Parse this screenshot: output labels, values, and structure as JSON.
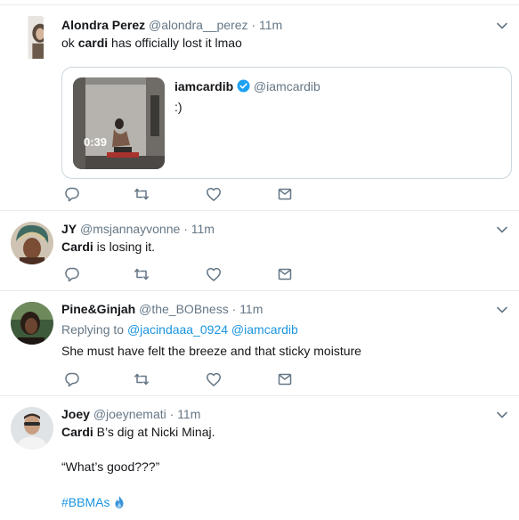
{
  "tweets": [
    {
      "name": "Alondra Perez",
      "handle": "@alondra__perez",
      "time": "11m",
      "text_pre": "ok ",
      "text_keyword": "cardi",
      "text_post": " has officially lost it lmao",
      "quoted": {
        "name": "iamcardib",
        "handle": "@iamcardib",
        "text": ":)",
        "video_duration": "0:39"
      }
    },
    {
      "name": "JY",
      "handle": "@msjannayvonne",
      "time": "11m",
      "text_keyword": "Cardi",
      "text_post": " is losing it."
    },
    {
      "name": "Pine&Ginjah",
      "handle": "@the_BOBness",
      "time": "11m",
      "reply_prefix": "Replying to ",
      "reply_to_1": "@jacindaaa_0924",
      "reply_to_2": "@iamcardib",
      "text": "She must have felt the breeze and that sticky moisture"
    },
    {
      "name": "Joey",
      "handle": "@joeynemati",
      "time": "11m",
      "text_keyword": "Cardi",
      "text_post": " B’s dig at Nicki Minaj.",
      "line2": "“What’s good???”",
      "hashtag": "#BBMAs"
    }
  ],
  "colors": {
    "accent": "#1b95e0",
    "icon_gray": "#657786",
    "verified": "#1da1f2"
  },
  "icons": [
    "reply-icon",
    "retweet-icon",
    "like-icon",
    "direct-message-icon",
    "chevron-down-icon",
    "verified-badge-icon",
    "fire-emoji-icon"
  ]
}
